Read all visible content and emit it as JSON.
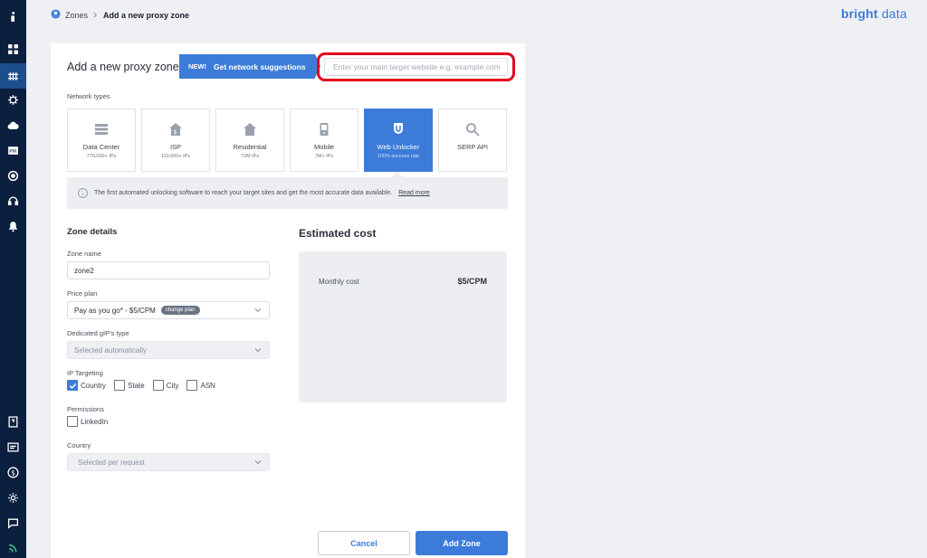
{
  "breadcrumb": {
    "parent": "Zones",
    "current": "Add a new proxy zone"
  },
  "brand": {
    "word1": "bright",
    "word2": "data",
    "color": "#3d7bd9"
  },
  "sidebar": {
    "icons": [
      "info-icon",
      "dashboard-icon",
      "proxies-icon",
      "scraper-icon",
      "cloud-icon",
      "pm-icon",
      "browser-icon",
      "support-icon",
      "notifications-icon",
      "docs-icon",
      "billing-icon",
      "dollar-icon",
      "settings-icon",
      "chat-icon",
      "status-icon"
    ],
    "active": "proxies-icon"
  },
  "header": {
    "title": "Add a new proxy zone",
    "suggest_new": "NEW!",
    "suggest_label": "Get network suggestions",
    "target_placeholder": "Enter your main target website e.g. example.com"
  },
  "network": {
    "label": "Network types",
    "types": [
      {
        "name": "Data Center",
        "sub": "770,000+ IPs",
        "icon": "server-icon",
        "selected": false
      },
      {
        "name": "ISP",
        "sub": "110,000+ IPs",
        "icon": "isp-house-icon",
        "selected": false
      },
      {
        "name": "Residential",
        "sub": "72M IPs",
        "icon": "house-icon",
        "selected": false
      },
      {
        "name": "Mobile",
        "sub": "7M+ IPs",
        "icon": "mobile-icon",
        "selected": false
      },
      {
        "name": "Web Unlocker",
        "sub": "100% success rate",
        "icon": "unlocker-icon",
        "selected": true
      },
      {
        "name": "SERP API",
        "sub": "",
        "icon": "search-icon",
        "selected": false
      }
    ],
    "info_text": "The first automated unlocking software to reach your target sites and get the most accurate data available.",
    "read_more": "Read more"
  },
  "zone": {
    "section_title": "Zone details",
    "name_label": "Zone name",
    "name_value": "zone2",
    "plan_label": "Price plan",
    "plan_value": "Pay as you go* - $5/CPM",
    "plan_badge": "change plan",
    "gip_label": "Dedicated gIP's type",
    "gip_value": "Selected automatically",
    "targeting_label": "IP Targeting",
    "targeting": [
      {
        "label": "Country",
        "checked": true
      },
      {
        "label": "State",
        "checked": false
      },
      {
        "label": "City",
        "checked": false
      },
      {
        "label": "ASN",
        "checked": false
      }
    ],
    "permissions_label": "Permissions",
    "permission_linkedin": "LinkedIn",
    "country_label": "Country",
    "country_value": "Selected per request"
  },
  "estimate": {
    "title": "Estimated cost",
    "monthly_label": "Monthly cost",
    "monthly_value": "$5/CPM"
  },
  "actions": {
    "cancel": "Cancel",
    "add": "Add Zone"
  }
}
